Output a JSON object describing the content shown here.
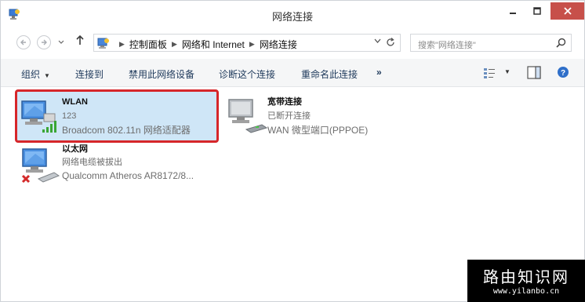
{
  "window": {
    "title": "网络连接",
    "controls": {
      "minimize": "minimize-icon",
      "maximize": "maximize-icon",
      "close": "close-icon",
      "close_color": "#c7504a"
    }
  },
  "address_bar": {
    "breadcrumbs": [
      "控制面板",
      "网络和 Internet",
      "网络连接"
    ],
    "search_placeholder": "搜索\"网络连接\""
  },
  "toolbar": {
    "organize": "组织",
    "connect_to": "连接到",
    "disable_device": "禁用此网络设备",
    "diagnose": "诊断这个连接",
    "rename": "重命名此连接",
    "more": "»"
  },
  "connections": [
    {
      "name": "WLAN",
      "status": "123",
      "adapter": "Broadcom 802.11n 网络适配器",
      "icon": "wifi-adapter-icon",
      "selected": true,
      "highlight_color": "#d6262a"
    },
    {
      "name": "宽带连接",
      "status": "已断开连接",
      "adapter": "WAN 微型端口(PPPOE)",
      "icon": "broadband-modem-icon",
      "selected": false
    },
    {
      "name": "以太网",
      "status": "网络电缆被拔出",
      "adapter": "Qualcomm Atheros AR8172/8...",
      "icon": "ethernet-disconnected-icon",
      "selected": false
    }
  ],
  "watermark": {
    "title": "路由知识网",
    "url": "www.yilanbo.cn"
  }
}
